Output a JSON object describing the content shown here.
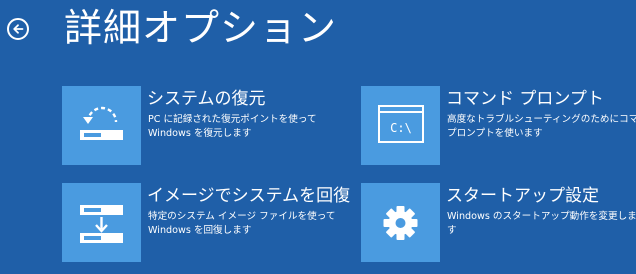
{
  "header": {
    "title": "詳細オプション",
    "back_icon": "back-arrow-icon"
  },
  "tiles": [
    {
      "title": "システムの復元",
      "desc_lines": [
        "PC に記録された復元ポイントを使って",
        "Windows を復元します"
      ],
      "icon": "system-restore-icon"
    },
    {
      "title": "コマンド プロンプト",
      "desc_lines": [
        "高度なトラブルシューティングのためにコマンド",
        "プロンプトを使います"
      ],
      "icon": "command-prompt-icon",
      "icon_text": "C:\\"
    },
    {
      "title": "イメージでシステムを回復",
      "desc_lines": [
        "特定のシステム イメージ ファイルを使って",
        "Windows を回復します"
      ],
      "icon": "system-image-recovery-icon"
    },
    {
      "title": "スタートアップ設定",
      "desc_lines": [
        "Windows のスタートアップ動作を変更しま",
        "す"
      ],
      "icon": "gear-icon"
    }
  ],
  "colors": {
    "background": "#1f5fa8",
    "tile_icon": "#4a9be0",
    "text": "#ffffff"
  }
}
